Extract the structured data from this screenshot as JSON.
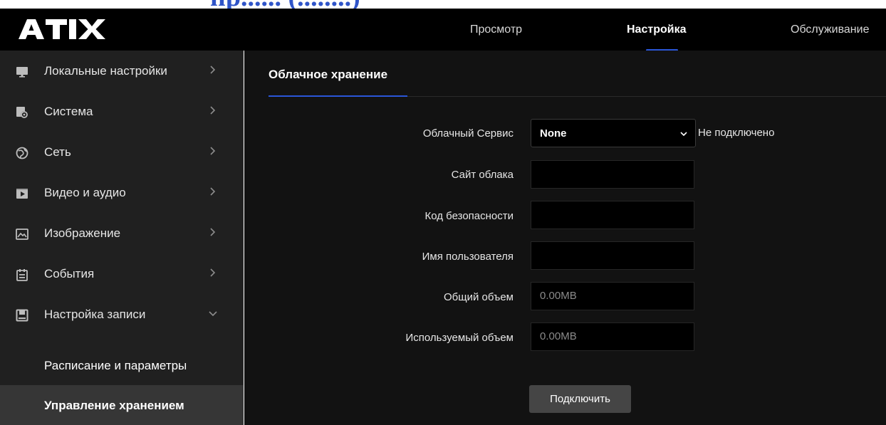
{
  "header": {
    "cut_text": "пр...... (........)",
    "logo_text": "ATIX",
    "tabs": [
      {
        "label": "Просмотр",
        "active": false
      },
      {
        "label": "Настройка",
        "active": true
      },
      {
        "label": "Обслуживание",
        "active": false
      }
    ],
    "accent_color": "#2a56d8"
  },
  "sidebar": {
    "items": [
      {
        "label": "Локальные настройки",
        "icon": "monitor-icon",
        "expanded": false
      },
      {
        "label": "Система",
        "icon": "system-gear-icon",
        "expanded": false
      },
      {
        "label": "Сеть",
        "icon": "globe-icon",
        "expanded": false
      },
      {
        "label": "Видео и аудио",
        "icon": "video-icon",
        "expanded": false
      },
      {
        "label": "Изображение",
        "icon": "image-icon",
        "expanded": false
      },
      {
        "label": "События",
        "icon": "calendar-icon",
        "expanded": false
      },
      {
        "label": "Настройка записи",
        "icon": "save-icon",
        "expanded": true
      }
    ],
    "subitems": [
      {
        "label": "Расписание и параметры",
        "active": false
      },
      {
        "label": "Управление хранением",
        "active": true
      }
    ]
  },
  "main": {
    "tab_label": "Облачное хранение",
    "form": {
      "cloud_service_label": "Облачный Сервис",
      "cloud_service_value": "None",
      "cloud_status": "Не подключено",
      "cloud_site_label": "Сайт облака",
      "cloud_site_value": "",
      "security_code_label": "Код безопасности",
      "security_code_value": "",
      "username_label": "Имя пользователя",
      "username_value": "",
      "total_volume_label": "Общий объем",
      "total_volume_value": "0.00MB",
      "used_volume_label": "Используемый объем",
      "used_volume_value": "0.00MB",
      "connect_label": "Подключить"
    }
  }
}
